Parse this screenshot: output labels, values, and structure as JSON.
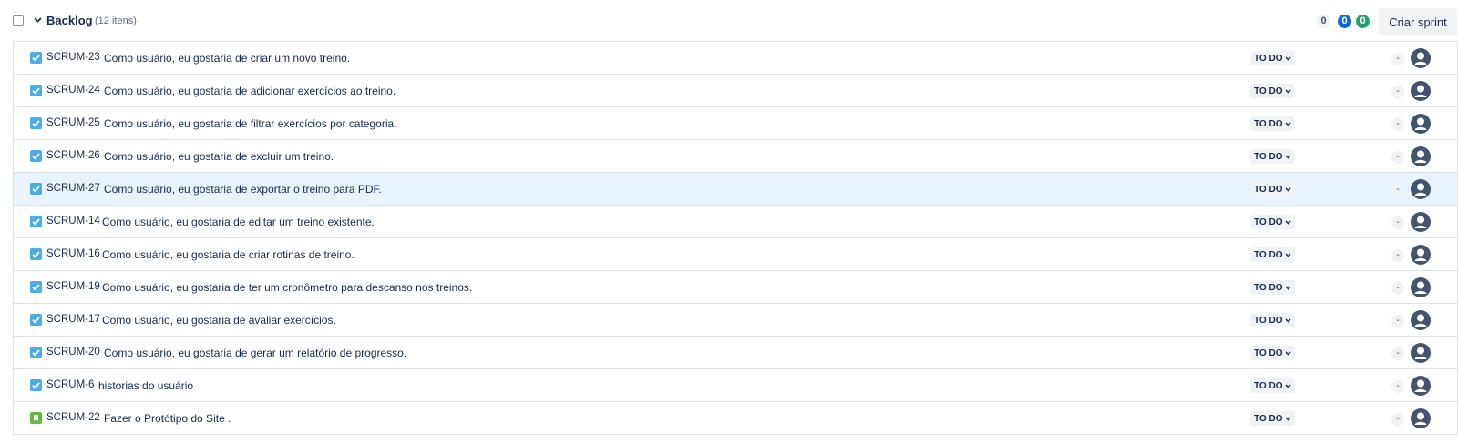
{
  "backlog": {
    "title": "Backlog",
    "count": "(12 itens)",
    "counts": {
      "todo": "0",
      "in_progress": "0",
      "done": "0"
    },
    "create_sprint_label": "Criar sprint",
    "colors": {
      "todo": "#f1f2f4",
      "in_progress": "#0c66e4",
      "done": "#22a06b",
      "selected_row": "#e9f2ff"
    }
  },
  "issues": [
    {
      "type": "task",
      "key": "SCRUM-23",
      "summary": "Como usuário, eu gostaria de criar um novo treino.",
      "status": "TO DO",
      "estimate": "-"
    },
    {
      "type": "task",
      "key": "SCRUM-24",
      "summary": "Como usuário, eu gostaria de adicionar exercícios ao treino.",
      "status": "TO DO",
      "estimate": "-"
    },
    {
      "type": "task",
      "key": "SCRUM-25",
      "summary": "Como usuário, eu gostaria de filtrar exercícios por categoria.",
      "status": "TO DO",
      "estimate": "-"
    },
    {
      "type": "task",
      "key": "SCRUM-26",
      "summary": "Como usuário, eu gostaria de excluir um treino.",
      "status": "TO DO",
      "estimate": "-"
    },
    {
      "type": "task",
      "key": "SCRUM-27",
      "summary": "Como usuário, eu gostaria de exportar o treino para PDF.",
      "status": "TO DO",
      "estimate": "-",
      "selected": true
    },
    {
      "type": "task",
      "key": "SCRUM-14",
      "summary": "Como usuário, eu gostaria de editar um treino existente.",
      "status": "TO DO",
      "estimate": "-"
    },
    {
      "type": "task",
      "key": "SCRUM-16",
      "summary": "Como usuário, eu gostaria de criar rotinas de treino.",
      "status": "TO DO",
      "estimate": "-"
    },
    {
      "type": "task",
      "key": "SCRUM-19",
      "summary": "Como usuário, eu gostaria de ter um cronômetro para descanso nos treinos.",
      "status": "TO DO",
      "estimate": "-"
    },
    {
      "type": "task",
      "key": "SCRUM-17",
      "summary": "Como usuário, eu gostaria de avaliar exercícios.",
      "status": "TO DO",
      "estimate": "-"
    },
    {
      "type": "task",
      "key": "SCRUM-20",
      "summary": "Como usuário, eu gostaria de gerar um relatório de progresso.",
      "status": "TO DO",
      "estimate": "-"
    },
    {
      "type": "task",
      "key": "SCRUM-6",
      "summary": "historias do usuário",
      "status": "TO DO",
      "estimate": "-"
    },
    {
      "type": "story",
      "key": "SCRUM-22",
      "summary": "Fazer o Protótipo do Site .",
      "status": "TO DO",
      "estimate": "-"
    }
  ]
}
